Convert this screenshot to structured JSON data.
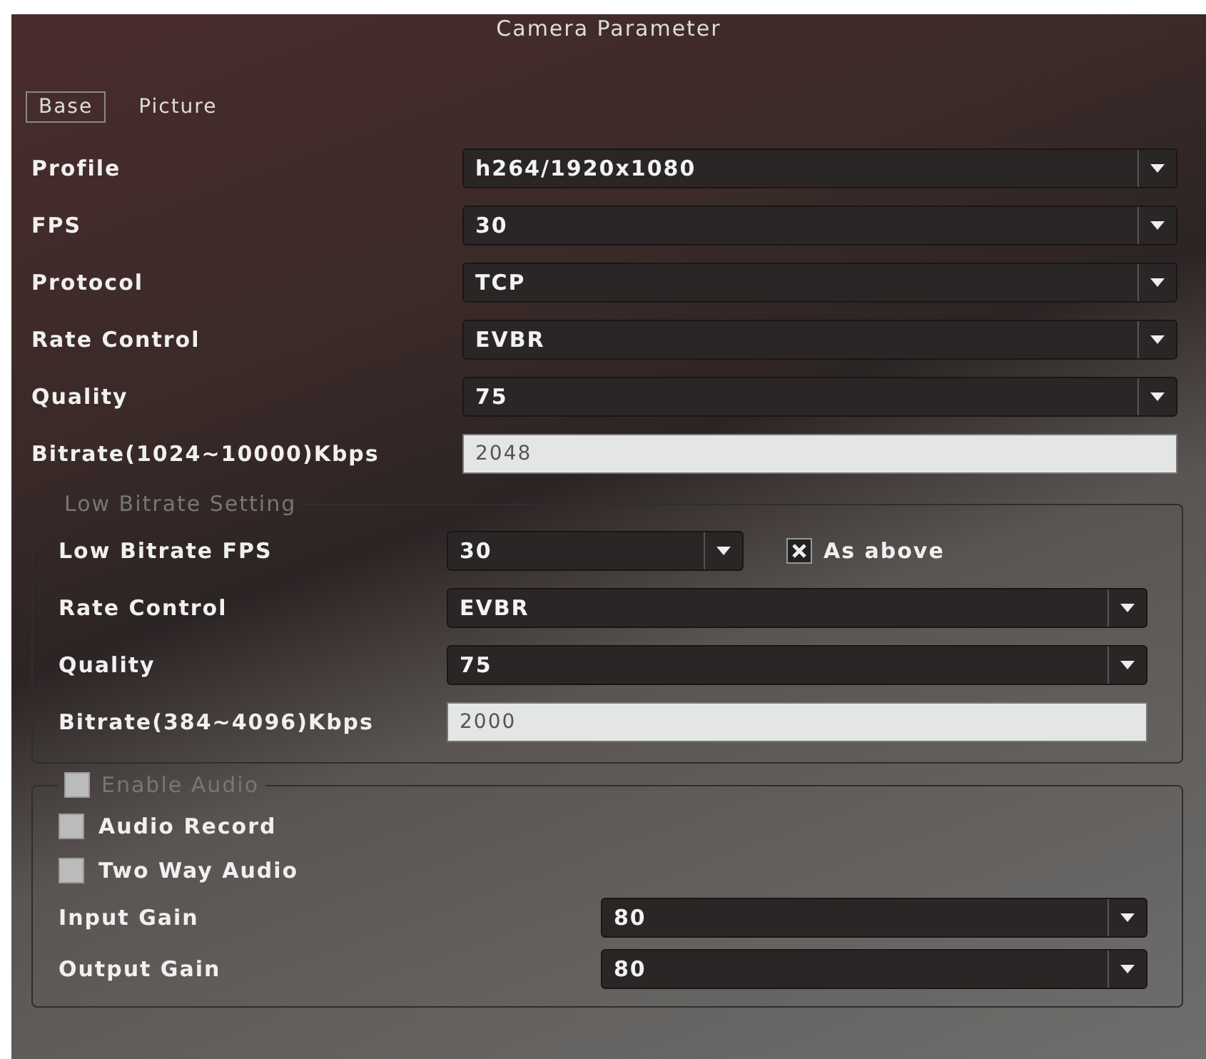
{
  "window": {
    "title": "Camera Parameter"
  },
  "tabs": [
    {
      "label": "Base",
      "selected": true
    },
    {
      "label": "Picture",
      "selected": false
    }
  ],
  "fields": [
    {
      "label": "Profile",
      "kind": "select",
      "value": "h264/1920x1080"
    },
    {
      "label": "FPS",
      "kind": "select",
      "value": "30"
    },
    {
      "label": "Protocol",
      "kind": "select",
      "value": "TCP"
    },
    {
      "label": "Rate Control",
      "kind": "select",
      "value": "EVBR"
    },
    {
      "label": "Quality",
      "kind": "select",
      "value": "75"
    },
    {
      "label": "Bitrate(1024~10000)Kbps",
      "kind": "input",
      "value": "2048"
    }
  ],
  "low_bitrate": {
    "title": "Low Bitrate Setting",
    "as_above": {
      "label": "As above",
      "checked": true
    },
    "fields": [
      {
        "label": "Low Bitrate FPS",
        "kind": "select",
        "value": "30"
      },
      {
        "label": "Rate Control",
        "kind": "select",
        "value": "EVBR"
      },
      {
        "label": "Quality",
        "kind": "select",
        "value": "75"
      },
      {
        "label": "Bitrate(384~4096)Kbps",
        "kind": "input",
        "value": "2000"
      }
    ]
  },
  "audio": {
    "title": "Enable Audio",
    "checked": false,
    "options": [
      {
        "label": "Audio Record",
        "checked": false
      },
      {
        "label": "Two Way Audio",
        "checked": false
      }
    ],
    "fields": [
      {
        "label": "Input Gain",
        "kind": "select",
        "value": "80"
      },
      {
        "label": "Output Gain",
        "kind": "select",
        "value": "80"
      }
    ]
  }
}
